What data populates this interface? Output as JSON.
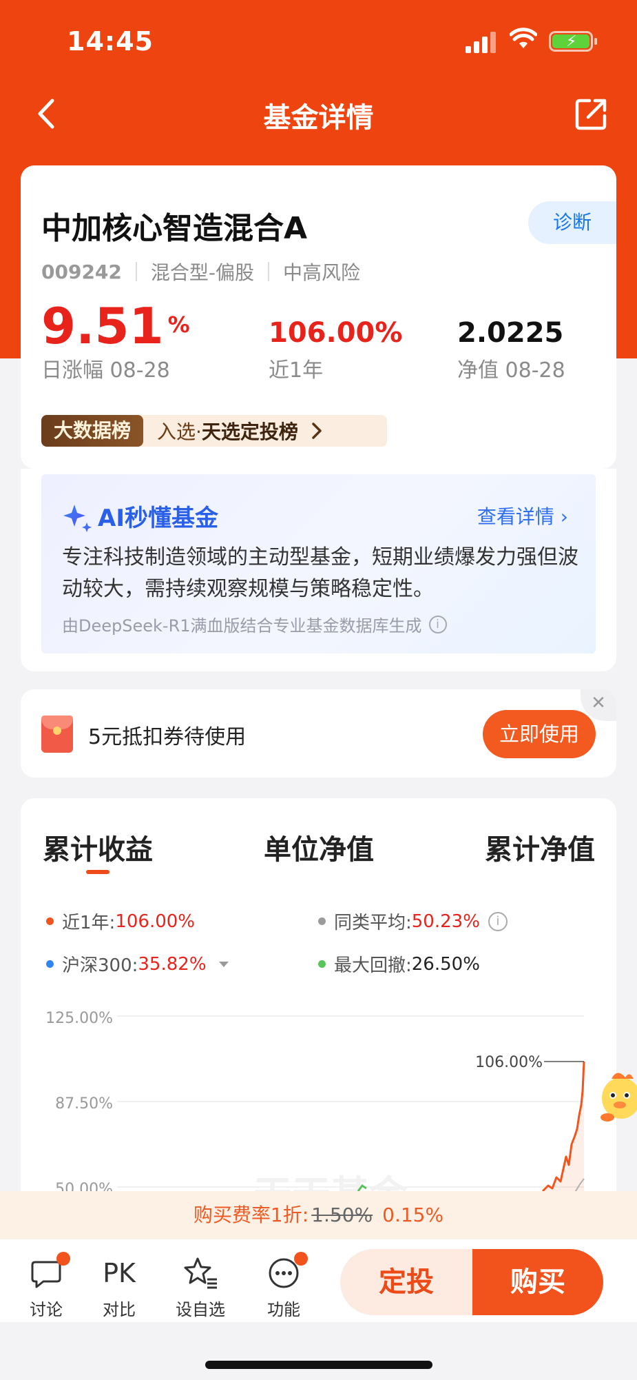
{
  "status_bar": {
    "time": "14:45"
  },
  "nav": {
    "title": "基金详情"
  },
  "fund": {
    "name": "中加核心智造混合A",
    "diagnose_label": "诊断",
    "code": "009242",
    "category": "混合型-偏股",
    "risk": "中高风险",
    "daily_change": "9.51",
    "daily_change_unit": "%",
    "daily_change_label": "日涨幅 08-28",
    "one_year_return": "106.00%",
    "one_year_label": "近1年",
    "nav_value": "2.0225",
    "nav_label": "净值 08-28",
    "rank_tag": "大数据榜",
    "rank_prefix": "入选·",
    "rank_name": "天选定投榜"
  },
  "ai_summary": {
    "title": "AI秒懂基金",
    "more_label": "查看详情",
    "description": "专注科技制造领域的主动型基金，短期业绩爆发力强但波动较大，需持续观察规模与策略稳定性。",
    "note": "由DeepSeek-R1满血版结合专业基金数据库生成",
    "info_glyph": "i"
  },
  "coupon": {
    "text": "5元抵扣券待使用",
    "button_label": "立即使用",
    "close_glyph": "✕"
  },
  "chart_section": {
    "tabs": [
      "累计收益",
      "单位净值",
      "累计净值"
    ],
    "active_tab": 0,
    "legend": [
      {
        "label": "近1年:",
        "value": "106.00%",
        "color": "#f2541d"
      },
      {
        "label": "同类平均:",
        "value": "50.23%",
        "color": "#9b9b9b"
      },
      {
        "label": "沪深300:",
        "value": "35.82%",
        "color": "#2f86f2"
      },
      {
        "label": "最大回撤:",
        "value": "26.50%",
        "color": "#58c45a"
      }
    ],
    "info_glyph": "i",
    "watermark": "天天基金",
    "peak_label": "106.00%"
  },
  "chart_data": {
    "type": "line",
    "ytick_labels": [
      "125.00%",
      "87.50%",
      "50.00%"
    ],
    "ylim_visible": [
      50,
      125
    ],
    "series": [
      {
        "name": "近1年",
        "final_value": 106.0
      },
      {
        "name": "同类平均",
        "final_value": 50.23
      },
      {
        "name": "沪深300",
        "final_value": 35.82
      }
    ],
    "annotation": "106.00%"
  },
  "fee_bar": {
    "prefix": "购买费率1折:",
    "old_rate": "1.50%",
    "new_rate": "0.15%"
  },
  "bottom_bar": {
    "tools": [
      {
        "label": "讨论",
        "icon": "chat-icon"
      },
      {
        "label": "对比",
        "icon": "pk-icon",
        "glyph": "PK"
      },
      {
        "label": "设自选",
        "icon": "star-list-icon"
      },
      {
        "label": "功能",
        "icon": "more-icon"
      }
    ],
    "invest_label": "定投",
    "buy_label": "购买"
  },
  "colors": {
    "brand": "#ee4410",
    "accent": "#f2531c",
    "rise": "#e8231c",
    "ai_blue": "#2a5fe8"
  }
}
